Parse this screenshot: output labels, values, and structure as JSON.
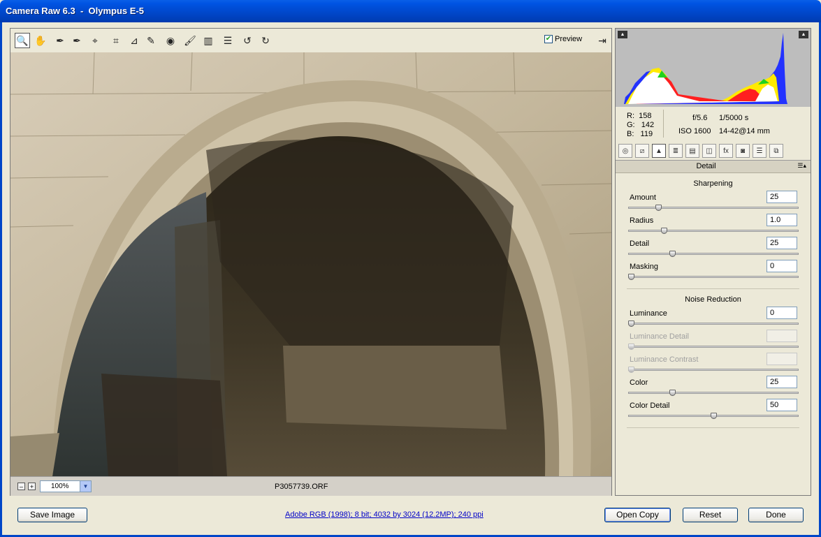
{
  "window": {
    "title": "Camera Raw 6.3  -  Olympus E-5"
  },
  "toolbar": {
    "tools": [
      {
        "name": "zoom-tool-icon",
        "glyph": "🔍"
      },
      {
        "name": "hand-tool-icon",
        "glyph": "✋"
      },
      {
        "name": "white-balance-tool-icon",
        "glyph": "✒"
      },
      {
        "name": "color-sampler-tool-icon",
        "glyph": "✒"
      },
      {
        "name": "targeted-adjustment-tool-icon",
        "glyph": "⌖"
      },
      {
        "name": "crop-tool-icon",
        "glyph": "⌗"
      },
      {
        "name": "straighten-tool-icon",
        "glyph": "⊿"
      },
      {
        "name": "spot-removal-tool-icon",
        "glyph": "✎"
      },
      {
        "name": "red-eye-removal-tool-icon",
        "glyph": "◉"
      },
      {
        "name": "adjustment-brush-icon",
        "glyph": "🖌"
      },
      {
        "name": "graduated-filter-icon",
        "glyph": "▥"
      },
      {
        "name": "preferences-icon",
        "glyph": "☰"
      },
      {
        "name": "rotate-left-icon",
        "glyph": "↺"
      },
      {
        "name": "rotate-right-icon",
        "glyph": "↻"
      }
    ],
    "preview_label": "Preview",
    "preview_checked": "✔"
  },
  "status": {
    "zoom_minus": "–",
    "zoom_plus": "+",
    "zoom_value": "100%",
    "filename": "P3057739.ORF"
  },
  "info": {
    "rgb_text": "R:  158\nG:   142\nB:   119",
    "aperture": "f/5.6",
    "shutter": "1/5000 s",
    "iso": "ISO 1600",
    "lens": "14-42@14 mm"
  },
  "tabs": [
    {
      "name": "tab-basic-icon",
      "glyph": "◎"
    },
    {
      "name": "tab-tone-curve-icon",
      "glyph": "⧄"
    },
    {
      "name": "tab-detail-icon",
      "glyph": "▲"
    },
    {
      "name": "tab-hsl-icon",
      "glyph": "≣"
    },
    {
      "name": "tab-split-toning-icon",
      "glyph": "▤"
    },
    {
      "name": "tab-lens-corrections-icon",
      "glyph": "◫"
    },
    {
      "name": "tab-effects-icon",
      "glyph": "fx"
    },
    {
      "name": "tab-camera-calibration-icon",
      "glyph": "◙"
    },
    {
      "name": "tab-presets-icon",
      "glyph": "☰"
    },
    {
      "name": "tab-snapshots-icon",
      "glyph": "⧉"
    }
  ],
  "panel": {
    "title": "Detail",
    "sharpening": {
      "heading": "Sharpening",
      "amount": {
        "label": "Amount",
        "value": "25",
        "level": 0.167
      },
      "radius": {
        "label": "Radius",
        "value": "1.0",
        "level": 0.2
      },
      "detail": {
        "label": "Detail",
        "value": "25",
        "level": 0.25
      },
      "masking": {
        "label": "Masking",
        "value": "0",
        "level": 0
      }
    },
    "noise": {
      "heading": "Noise Reduction",
      "luminance": {
        "label": "Luminance",
        "value": "0",
        "level": 0
      },
      "luminance_detail": {
        "label": "Luminance Detail",
        "value": "",
        "level": 0
      },
      "luminance_contrast": {
        "label": "Luminance Contrast",
        "value": "",
        "level": 0
      },
      "color": {
        "label": "Color",
        "value": "25",
        "level": 0.25
      },
      "color_detail": {
        "label": "Color Detail",
        "value": "50",
        "level": 0.5
      }
    }
  },
  "bottom": {
    "save_label": "Save Image",
    "workflow_link": "Adobe RGB (1998); 8 bit; 4032 by 3024 (12.2MP); 240 ppi",
    "open_label": "Open Copy",
    "reset_label": "Reset",
    "done_label": "Done"
  }
}
